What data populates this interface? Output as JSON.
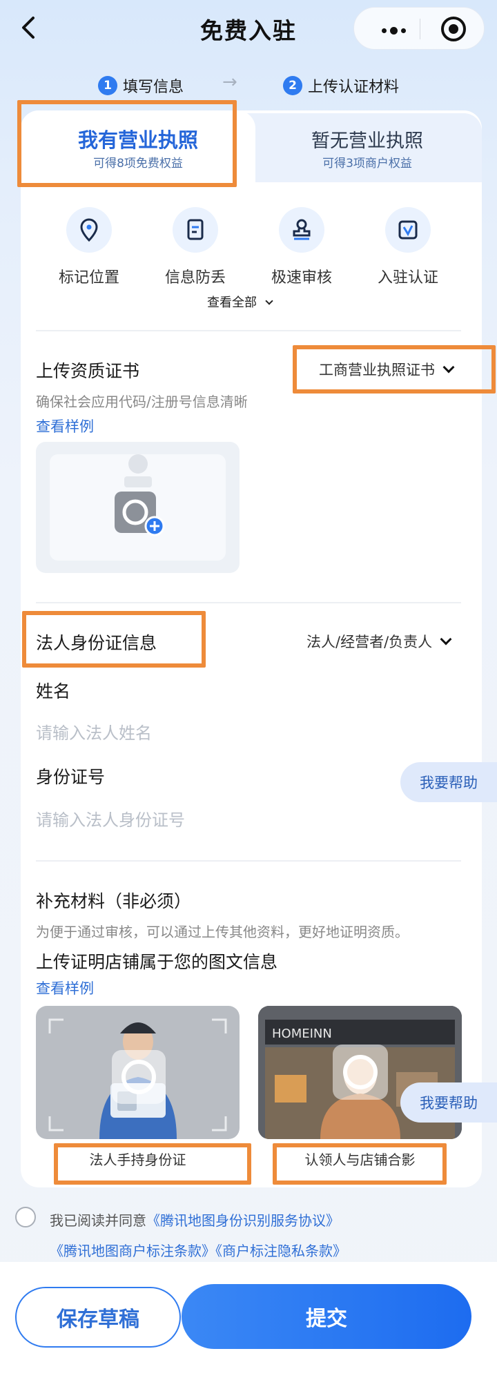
{
  "header": {
    "title": "免费入驻",
    "back_icon": "chevron-left-icon",
    "more_icon": "more-dots-icon",
    "close_icon": "target-icon"
  },
  "steps": [
    {
      "num": "1",
      "label": "填写信息"
    },
    {
      "num": "2",
      "label": "上传认证材料"
    }
  ],
  "tabs": [
    {
      "title": "我有营业执照",
      "subtitle": "可得8项免费权益",
      "active": true
    },
    {
      "title": "暂无营业执照",
      "subtitle": "可得3项商户权益",
      "active": false
    }
  ],
  "benefits": [
    {
      "label": "标记位置",
      "icon": "location-pin-icon"
    },
    {
      "label": "信息防丢",
      "icon": "document-icon"
    },
    {
      "label": "极速审核",
      "icon": "stamp-icon"
    },
    {
      "label": "入驻认证",
      "icon": "verified-badge-icon"
    }
  ],
  "view_all": "查看全部",
  "qualification": {
    "title": "上传资质证书",
    "type_select": "工商营业执照证书",
    "hint": "确保社会应用代码/注册号信息清晰",
    "sample_link": "查看样例"
  },
  "legal_person": {
    "title": "法人身份证信息",
    "role_select": "法人/经营者/负责人",
    "name_label": "姓名",
    "name_placeholder": "请输入法人姓名",
    "id_label": "身份证号",
    "id_placeholder": "请输入法人身份证号"
  },
  "help_button": "我要帮助",
  "supplement": {
    "title": "补充材料（非必须）",
    "hint": "为便于通过审核，可以通过上传其他资料，更好地证明资质。",
    "subtitle": "上传证明店铺属于您的图文信息",
    "sample_link": "查看样例",
    "photo1_caption": "法人手持身份证",
    "photo2_caption": "认领人与店铺合影",
    "storefront_sign": "HOMEINN"
  },
  "agreement": {
    "prefix": "我已阅读并同意",
    "link1": "《腾讯地图身份识别服务协议》",
    "link2": "《腾讯地图商户标注条款》",
    "link3": "《商户标注隐私条款》"
  },
  "actions": {
    "save_draft": "保存草稿",
    "submit": "提交"
  },
  "colors": {
    "accent": "#2f7bf0",
    "highlight": "#ee8b3a"
  }
}
